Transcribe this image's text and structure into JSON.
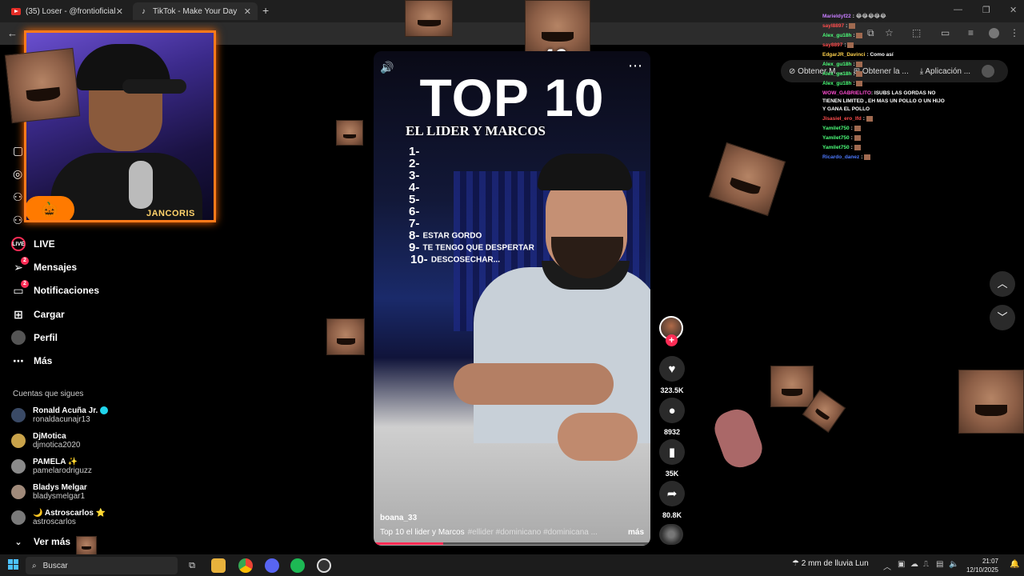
{
  "browser": {
    "tabs": [
      {
        "label": "(35) Loser - @frontioficial x @",
        "icon": "youtube-icon"
      },
      {
        "label": "TikTok - Make Your Day",
        "icon": "tiktok-icon"
      }
    ],
    "extensions": [
      "Obtener M...",
      "Obtener la ...",
      "Aplicación ..."
    ]
  },
  "sidebar": {
    "items": [
      {
        "label": "LIVE",
        "icon": "live-icon"
      },
      {
        "label": "Mensajes",
        "icon": "messages-icon",
        "badge": "2"
      },
      {
        "label": "Notificaciones",
        "icon": "notifications-icon",
        "badge": "2"
      },
      {
        "label": "Cargar",
        "icon": "upload-icon"
      },
      {
        "label": "Perfil",
        "icon": "profile-icon"
      },
      {
        "label": "Más",
        "icon": "more-icon"
      }
    ],
    "following_title": "Cuentas que sigues",
    "following": [
      {
        "name": "Ronald Acuña Jr.",
        "handle": "ronaldacunajr13"
      },
      {
        "name": "DjMotica",
        "handle": "djmotica2020"
      },
      {
        "name": "PAMELA ✨",
        "handle": "pamelarodriguzz"
      },
      {
        "name": "Bladys Melgar",
        "handle": "bladysmelgar1"
      },
      {
        "name": "🌙 Astroscarlos ⭐",
        "handle": "astroscarlos"
      }
    ],
    "see_more": "Ver más"
  },
  "webcam": {
    "name": "JANCORIS"
  },
  "overlay": {
    "multiplier": "x40"
  },
  "video": {
    "title_big": "TOP 10",
    "subtitle": "EL LIDER Y MARCOS",
    "ranks": [
      {
        "n": "1-",
        "t": ""
      },
      {
        "n": "2-",
        "t": ""
      },
      {
        "n": "3-",
        "t": ""
      },
      {
        "n": "4-",
        "t": ""
      },
      {
        "n": "5-",
        "t": ""
      },
      {
        "n": "6-",
        "t": ""
      },
      {
        "n": "7-",
        "t": ""
      },
      {
        "n": "8-",
        "t": "ESTAR GORDO"
      },
      {
        "n": "9-",
        "t": "TE TENGO QUE DESPERTAR"
      },
      {
        "n": "10-",
        "t": "DESCOSECHAR..."
      }
    ],
    "author": "boana_33",
    "caption": "Top 10 el lider y Marcos",
    "hashtags": "#ellider #dominicano #dominicana ...",
    "more_label": "más",
    "progress": 0.25
  },
  "actions": {
    "likes": "323.5K",
    "comments": "8932",
    "saves": "35K",
    "shares": "80.8K"
  },
  "chat": [
    {
      "user": "Marieldyf22",
      "msg": "😂😂😂😂😂",
      "color": "#c77dff"
    },
    {
      "user": "sayl8897",
      "msg": "",
      "color": "#ff4d4d"
    },
    {
      "user": "Alex_gu18h",
      "msg": "",
      "color": "#4cff7a"
    },
    {
      "user": "say8897",
      "msg": "",
      "color": "#ff4d4d"
    },
    {
      "user": "EdgarJR_Davinci",
      "msg": "Como así",
      "color": "#ffd24d"
    },
    {
      "user": "Alex_gu18h",
      "msg": "",
      "color": "#4cff7a"
    },
    {
      "user": "Alex_gu18h",
      "msg": "",
      "color": "#4cff7a"
    },
    {
      "user": "Alex_gu18h",
      "msg": "",
      "color": "#4cff7a"
    },
    {
      "user": "WOW_GABRIELITO",
      "msg": "ISUBS LAS GORDAS NO TIENEN LIMITED , EH MAS UN POLLO O UN HIJO Y GANA EL POLLO",
      "color": "#ff4dd2"
    },
    {
      "user": "Jisasiel_ero_lfd",
      "msg": "",
      "color": "#ff4d4d"
    },
    {
      "user": "Yamilet750",
      "msg": "",
      "color": "#4cff7a"
    },
    {
      "user": "Yamilet750",
      "msg": "",
      "color": "#4cff7a"
    },
    {
      "user": "Yamilet750",
      "msg": "",
      "color": "#4cff7a"
    },
    {
      "user": "Ricardo_danez",
      "msg": "",
      "color": "#4d7aff"
    }
  ],
  "taskbar": {
    "search": "Buscar",
    "weather": "2 mm de lluvia Lun",
    "time": "21:07",
    "date": "12/10/2025"
  },
  "colors": {
    "accent": "#fe2c55",
    "webcam_border": "#ff7a1a"
  }
}
